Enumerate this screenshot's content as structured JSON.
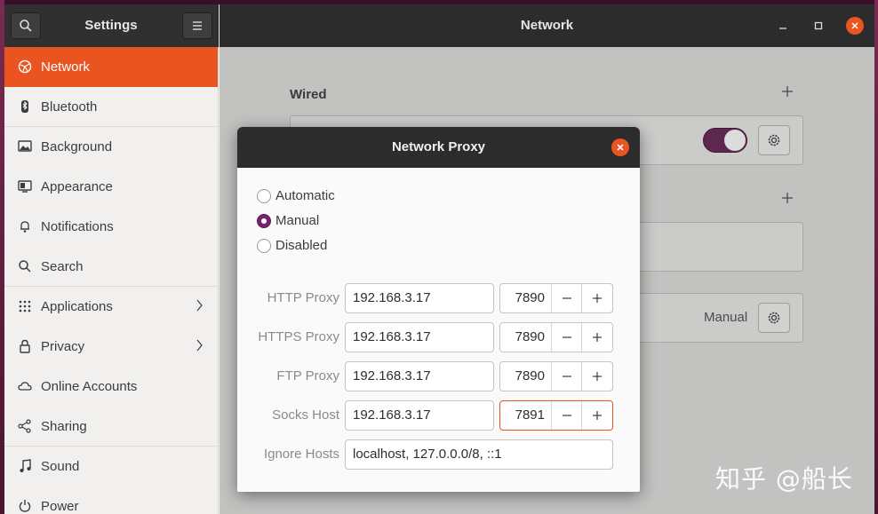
{
  "settings_header": {
    "title": "Settings"
  },
  "network_header": {
    "title": "Network"
  },
  "sidebar": {
    "items": [
      {
        "label": "Network",
        "icon": "network-icon"
      },
      {
        "label": "Bluetooth",
        "icon": "bluetooth-icon"
      },
      {
        "label": "Background",
        "icon": "background-icon"
      },
      {
        "label": "Appearance",
        "icon": "appearance-icon"
      },
      {
        "label": "Notifications",
        "icon": "bell-icon"
      },
      {
        "label": "Search",
        "icon": "search-icon"
      },
      {
        "label": "Applications",
        "icon": "grid-icon"
      },
      {
        "label": "Privacy",
        "icon": "lock-icon"
      },
      {
        "label": "Online Accounts",
        "icon": "cloud-icon"
      },
      {
        "label": "Sharing",
        "icon": "share-icon"
      },
      {
        "label": "Sound",
        "icon": "music-note-icon"
      },
      {
        "label": "Power",
        "icon": "power-icon"
      }
    ]
  },
  "main": {
    "wired_title": "Wired",
    "proxy_status": "Manual"
  },
  "dialog": {
    "title": "Network Proxy",
    "methods": [
      {
        "label": "Automatic",
        "selected": false
      },
      {
        "label": "Manual",
        "selected": true
      },
      {
        "label": "Disabled",
        "selected": false
      }
    ],
    "proxies": [
      {
        "label": "HTTP Proxy",
        "host": "192.168.3.17",
        "port": "7890"
      },
      {
        "label": "HTTPS Proxy",
        "host": "192.168.3.17",
        "port": "7890"
      },
      {
        "label": "FTP Proxy",
        "host": "192.168.3.17",
        "port": "7890"
      },
      {
        "label": "Socks Host",
        "host": "192.168.3.17",
        "port": "7891"
      }
    ],
    "ignore_label": "Ignore Hosts",
    "ignore_value": "localhost, 127.0.0.0/8, ::1"
  },
  "watermark": "知乎 @船长",
  "colors": {
    "accent": "#e95420",
    "toggle_on": "#5e2750",
    "radio_on": "#77216f"
  }
}
